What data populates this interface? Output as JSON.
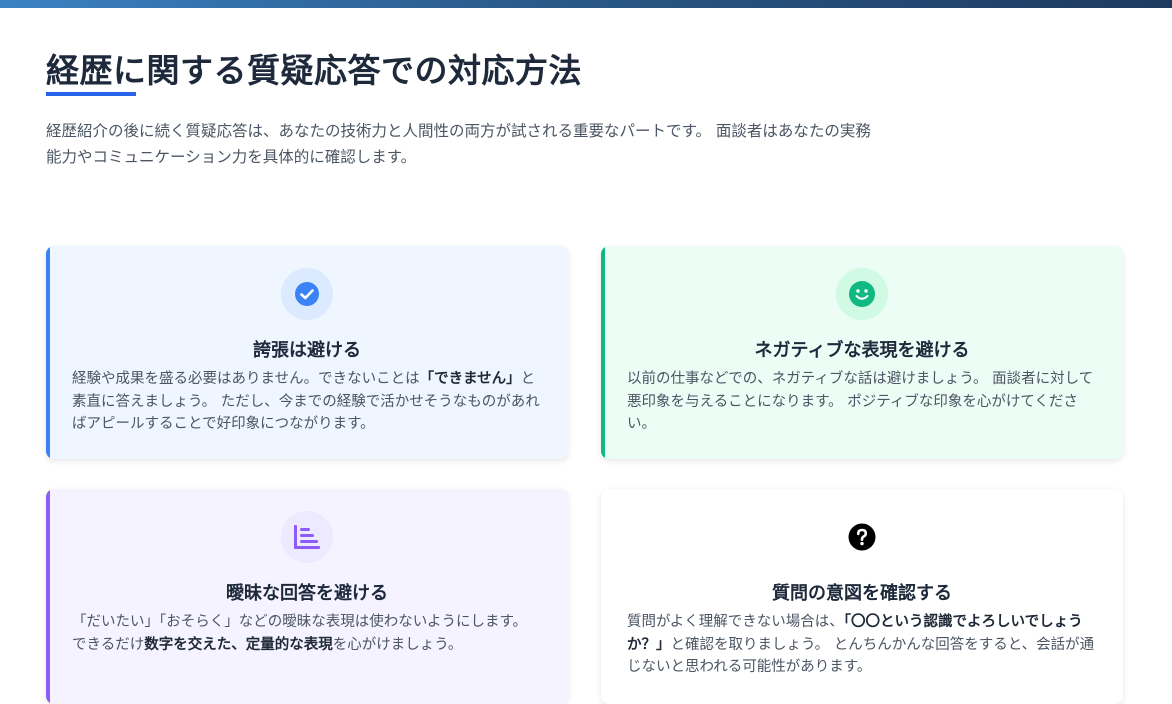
{
  "header": {
    "title": "経歴に関する質疑応答での対応方法",
    "intro": "経歴紹介の後に続く質疑応答は、あなたの技術力と人間性の両方が試される重要なパートです。 面談者はあなたの実務能力やコミュニケーション力を具体的に確認します。"
  },
  "cards": [
    {
      "title": "誇張は避ける",
      "icon": "check-circle-icon",
      "accent_color": "#3b82f6",
      "background": "#eff6ff",
      "icon_bg": "#dbeafe",
      "body": [
        {
          "t": "経験や成果を盛る必要はありません。できないことは"
        },
        {
          "t": "「できません」",
          "bold": true
        },
        {
          "t": "と素直に答えましょう。 ただし、今までの経験で活かせそうなものがあればアピールすることで好印象につながります。"
        }
      ]
    },
    {
      "title": "ネガティブな表現を避ける",
      "icon": "smile-icon",
      "accent_color": "#10b981",
      "background": "#ecfdf5",
      "icon_bg": "#d1fae5",
      "body": [
        {
          "t": "以前の仕事などでの、ネガティブな話は避けましょう。 面談者に対して悪印象を与えることになります。 ポジティブな印象を心がけてください。"
        }
      ]
    },
    {
      "title": "曖昧な回答を避ける",
      "icon": "bar-chart-icon",
      "accent_color": "#8b5cf6",
      "background": "#f5f3ff",
      "icon_bg": "#ede9fe",
      "body": [
        {
          "t": "「だいたい」「おそらく」などの曖昧な表現は使わないようにします。 できるだけ"
        },
        {
          "t": "数字を交えた、定量的な表現",
          "bold": true
        },
        {
          "t": "を心がけましょう。"
        }
      ]
    },
    {
      "title": "質問の意図を確認する",
      "icon": "question-circle-icon",
      "accent_color": "#ffffff",
      "background": "#ffffff",
      "icon_bg": "#ffffff",
      "body": [
        {
          "t": "質問がよく理解できない場合は、"
        },
        {
          "t": "「〇〇という認識でよろしいでしょうか？」",
          "bold": true
        },
        {
          "t": "と確認を取りましょう。 とんちんかんな回答をすると、会話が通じないと思われる可能性があります。"
        }
      ]
    }
  ]
}
